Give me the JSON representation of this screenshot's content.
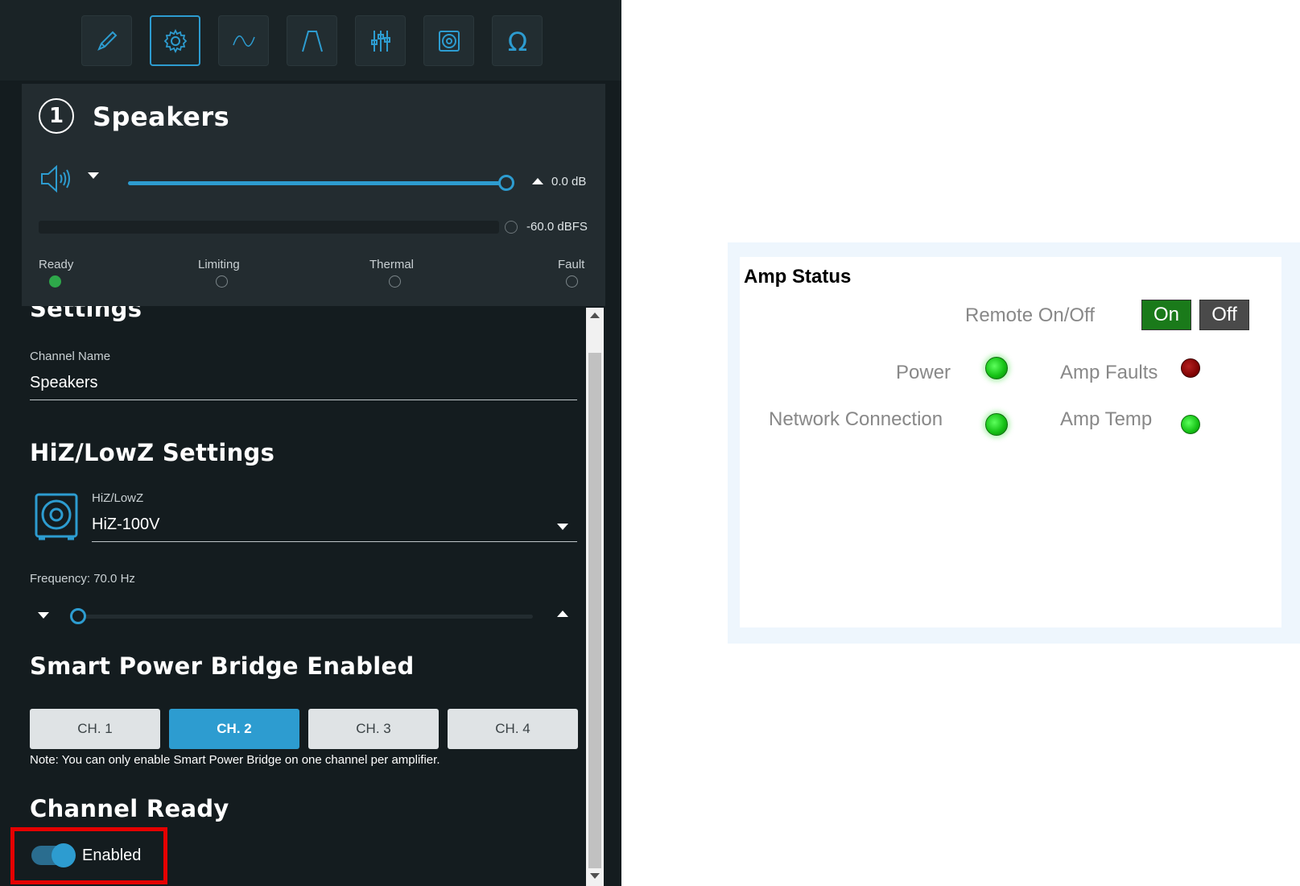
{
  "toolbar": {
    "buttons": [
      {
        "icon": "pen-icon",
        "active": false
      },
      {
        "icon": "gear-icon",
        "active": true
      },
      {
        "icon": "wave-icon",
        "active": false
      },
      {
        "icon": "filter-icon",
        "active": false
      },
      {
        "icon": "sliders-icon",
        "active": false
      },
      {
        "icon": "speaker-box-icon",
        "active": false
      },
      {
        "icon": "omega-icon",
        "active": false
      }
    ]
  },
  "channel": {
    "number": "1",
    "title": "Speakers",
    "volume_db": "0.0 dB",
    "volume_fraction": 1.0,
    "meter_value": "-60.0 dBFS",
    "indicators": [
      {
        "label": "Ready",
        "on": true
      },
      {
        "label": "Limiting",
        "on": false
      },
      {
        "label": "Thermal",
        "on": false
      },
      {
        "label": "Fault",
        "on": false
      }
    ]
  },
  "settings": {
    "title": "Settings",
    "channel_name_label": "Channel Name",
    "channel_name_value": "Speakers",
    "hiz_title": "HiZ/LowZ Settings",
    "hiz_label": "HiZ/LowZ",
    "hiz_value": "HiZ-100V",
    "frequency_label": "Frequency: 70.0 Hz",
    "frequency_fraction": 0.0,
    "spb_title": "Smart Power Bridge Enabled",
    "channels": [
      "CH. 1",
      "CH. 2",
      "CH. 3",
      "CH. 4"
    ],
    "active_channel": "CH. 2",
    "note": "Note: You can only enable Smart Power Bridge on one channel per amplifier.",
    "ready_title": "Channel Ready",
    "ready_toggle_label": "Enabled",
    "ready_enabled": true
  },
  "amp_status": {
    "title": "Amp Status",
    "remote_label": "Remote On/Off",
    "on_label": "On",
    "off_label": "Off",
    "power_label": "Power",
    "amp_faults_label": "Amp Faults",
    "network_label": "Network Connection",
    "amp_temp_label": "Amp Temp",
    "colors": {
      "on_button": "#1a7a1a",
      "off_button": "#4a4a4a",
      "led_green": "#16c216",
      "led_red": "#7a0000"
    }
  },
  "colors": {
    "accent": "#2d9cd0",
    "panel_bg": "#141c1f",
    "highlight": "#e50000"
  }
}
